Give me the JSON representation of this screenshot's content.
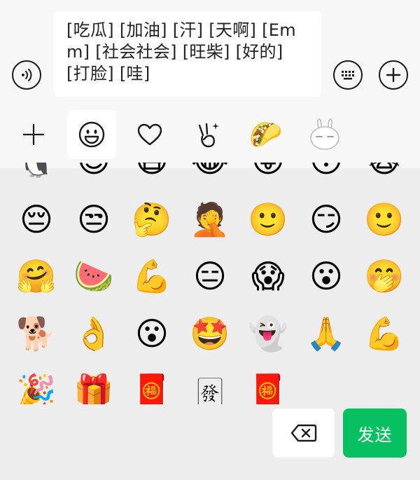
{
  "input": {
    "text": "[吃瓜] [加油] [汗] [天啊] [Emm] [社会社会] [旺柴] [好的] [打脸] [哇]"
  },
  "toolbar": {
    "voice_icon": "voice-icon",
    "keyboard_icon": "keyboard-icon",
    "add_icon": "plus-icon"
  },
  "tabs": [
    {
      "id": "add",
      "icon": "plus-icon",
      "active": false
    },
    {
      "id": "emoji",
      "icon": "smiley-icon",
      "active": true
    },
    {
      "id": "favorites",
      "icon": "heart-icon",
      "active": false
    },
    {
      "id": "gestures",
      "icon": "victory-hand-icon",
      "active": false
    },
    {
      "id": "food-sticker",
      "icon": "taco-icon",
      "active": false
    },
    {
      "id": "rabbit-sticker",
      "icon": "rabbit-icon",
      "active": false
    }
  ],
  "emoji_grid": {
    "partial_row": [
      "🐧",
      "😊",
      "😷",
      "😂",
      "😛",
      "😳",
      "🙀"
    ],
    "rows": [
      [
        "😔",
        "😒",
        "🤔",
        "🤦",
        "🙂",
        "😏",
        "🙂"
      ],
      [
        "🤗",
        "🍉",
        "💪",
        "😑",
        "😱",
        "😮",
        "🤭"
      ],
      [
        "🐕",
        "👌",
        "😮",
        "🤩",
        "👻",
        "🙏",
        "💪"
      ],
      [
        "🎉",
        "🎁",
        "🧧",
        "🀅",
        "🧧"
      ]
    ]
  },
  "actions": {
    "delete_icon": "backspace-icon",
    "send_label": "发送",
    "send_color": "#07c160"
  }
}
